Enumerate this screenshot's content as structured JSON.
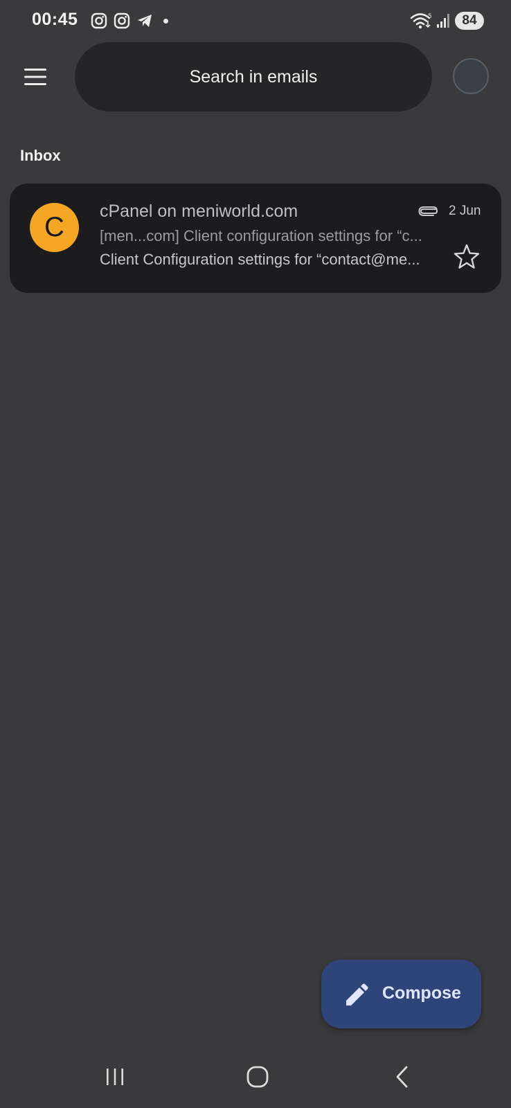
{
  "status_bar": {
    "time": "00:45",
    "battery": "84",
    "icons": [
      "instagram-icon",
      "instagram-icon",
      "telegram-icon",
      "wifi-icon",
      "signal-icon"
    ]
  },
  "top_bar": {
    "search_placeholder": "Search in emails"
  },
  "inbox": {
    "label": "Inbox",
    "emails": [
      {
        "avatar_letter": "C",
        "avatar_color": "#f5a623",
        "sender": "cPanel on meniworld.com",
        "subject": "[men...com] Client configuration settings for “c...",
        "snippet": "Client Configuration settings for “contact@me...",
        "date": "2 Jun",
        "has_attachment": true,
        "starred": false
      }
    ]
  },
  "compose": {
    "label": "Compose"
  },
  "colors": {
    "background": "#3a3a3c",
    "search_bg": "#252527",
    "card_bg": "#1c1c1e",
    "compose_bg": "#2f4478"
  }
}
